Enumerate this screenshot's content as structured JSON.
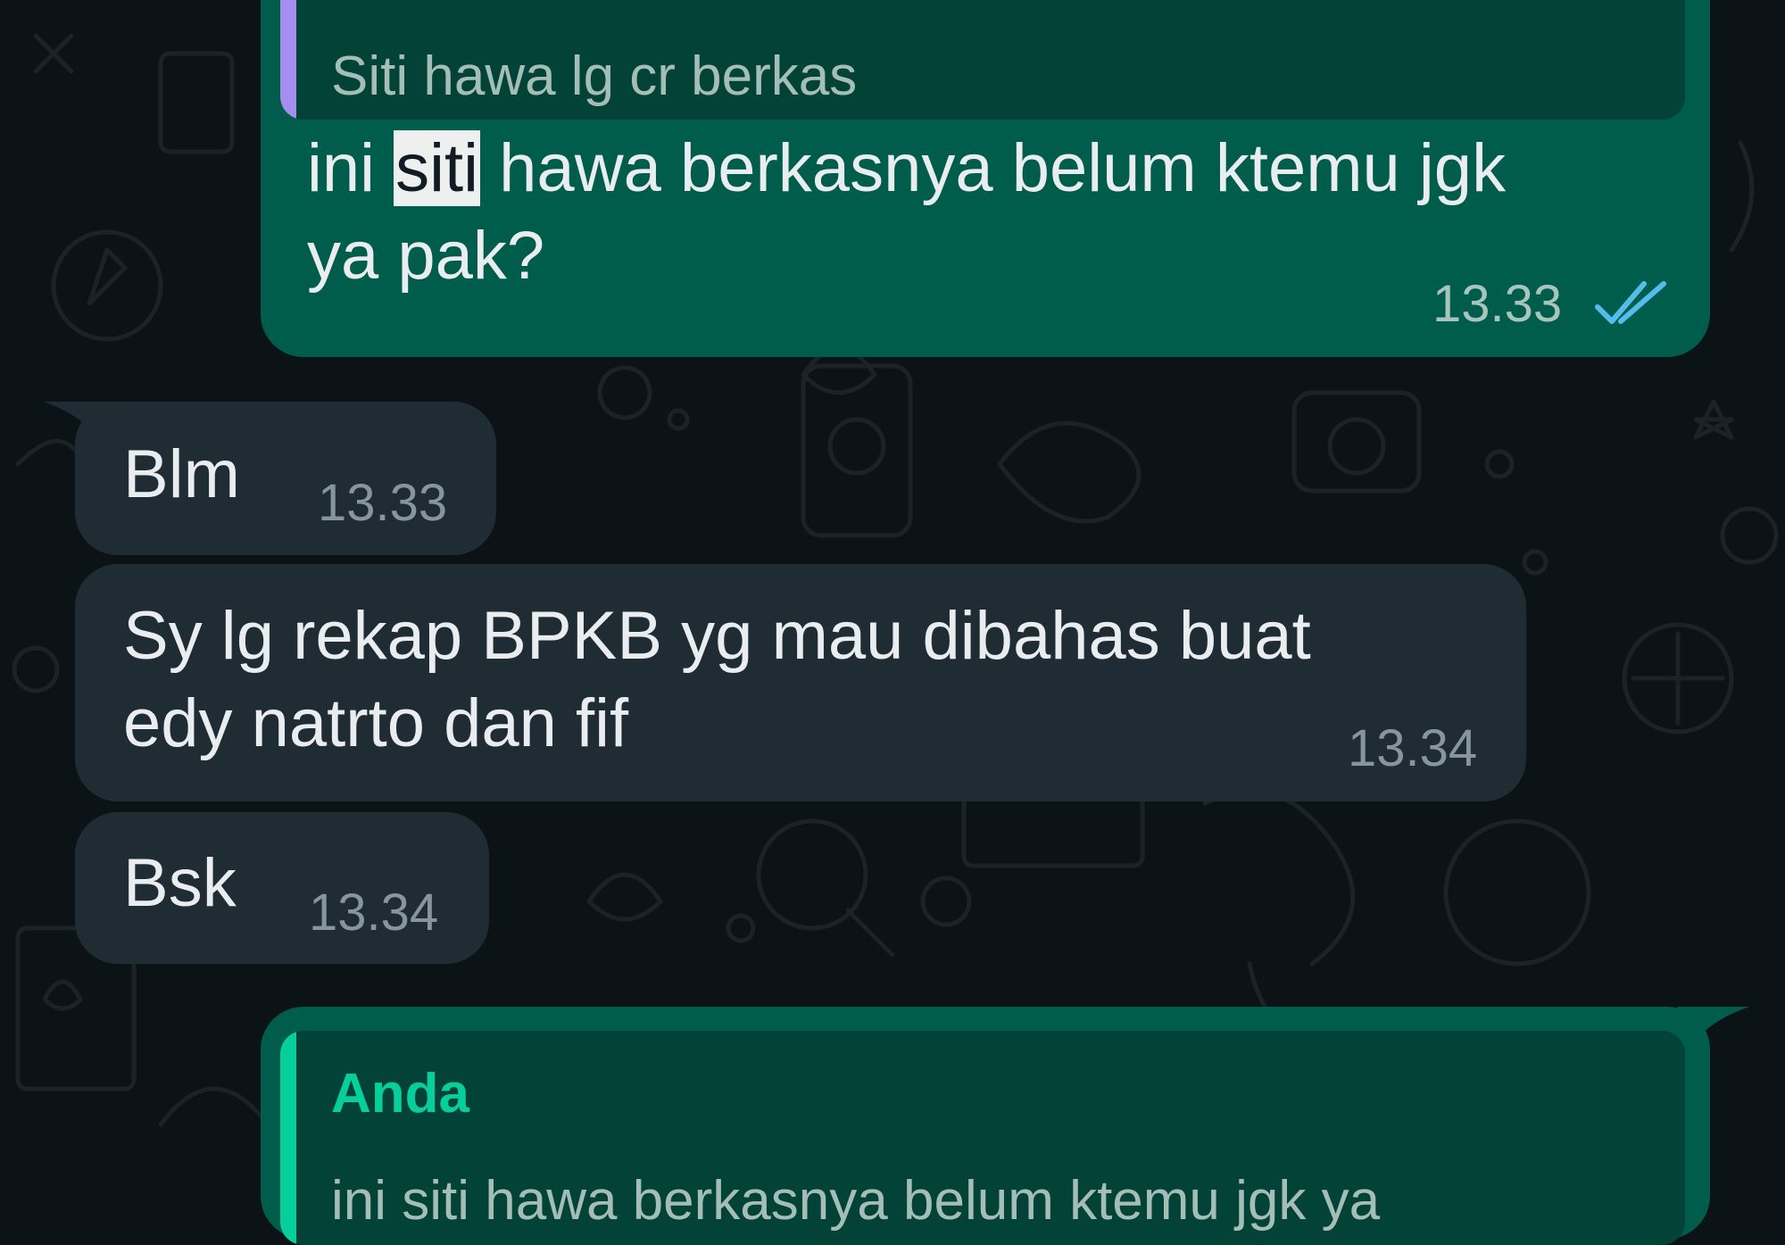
{
  "colors": {
    "outgoing_bubble": "#005c4b",
    "incoming_bubble": "#202c33",
    "background": "#0c1317",
    "read_ticks": "#53bdeb",
    "quote_bar_other": "#a68df0",
    "quote_bar_self": "#06cf9c"
  },
  "messages": [
    {
      "direction": "outgoing",
      "quote": {
        "text": "Siti hawa lg cr berkas"
      },
      "text_before": "ini ",
      "text_highlight": "siti",
      "text_after": " hawa berkasnya belum ktemu jgk",
      "text_line2": "ya pak?",
      "time": "13.33",
      "status_icon": "double-check-read-icon"
    },
    {
      "direction": "incoming",
      "text": "Blm",
      "time": "13.33"
    },
    {
      "direction": "incoming",
      "text_line1": "Sy lg rekap BPKB yg mau dibahas buat",
      "text_line2": "edy natrto dan fif",
      "time": "13.34"
    },
    {
      "direction": "incoming",
      "text": "Bsk",
      "time": "13.34"
    },
    {
      "direction": "outgoing",
      "quote": {
        "author": "Anda",
        "text": "ini siti hawa berkasnya belum ktemu jgk ya"
      }
    }
  ]
}
